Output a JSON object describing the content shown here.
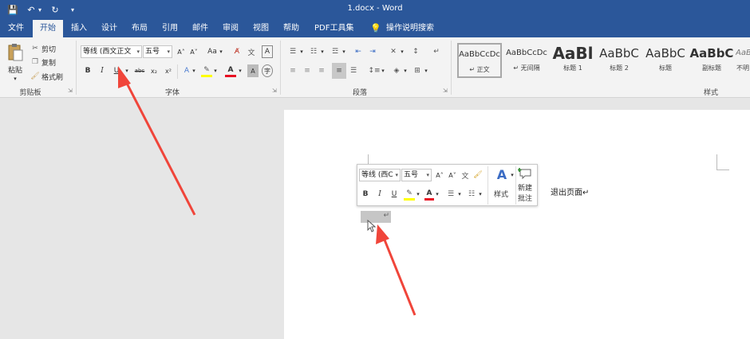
{
  "titlebar": {
    "title": "1.docx  -  Word",
    "quick_access": {
      "save": "💾",
      "undo": "↶",
      "undo_more": "▾",
      "redo": "↻",
      "customize": "▾"
    }
  },
  "tabs": [
    {
      "label": "文件"
    },
    {
      "label": "开始"
    },
    {
      "label": "插入"
    },
    {
      "label": "设计"
    },
    {
      "label": "布局"
    },
    {
      "label": "引用"
    },
    {
      "label": "邮件"
    },
    {
      "label": "审阅"
    },
    {
      "label": "视图"
    },
    {
      "label": "帮助"
    },
    {
      "label": "PDF工具集"
    },
    {
      "label": "操作说明搜索"
    }
  ],
  "clipboard": {
    "paste": "粘贴",
    "cut": "剪切",
    "copy": "复制",
    "format_painter": "格式刷",
    "group_label": "剪贴板"
  },
  "font": {
    "font_name": "等线 (西文正文",
    "font_size": "五号",
    "grow": "A˄",
    "shrink": "A˅",
    "case": "Aa",
    "clear": "A",
    "bold": "B",
    "italic": "I",
    "underline": "U",
    "strike": "abc",
    "subscript": "x₂",
    "superscript": "x²",
    "group_label": "字体"
  },
  "paragraph": {
    "group_label": "段落"
  },
  "styles": {
    "group_label": "样式",
    "items": [
      {
        "sample": "AaBbCcDc",
        "name": "↵ 正文"
      },
      {
        "sample": "AaBbCcDc",
        "name": "↵ 无间隔"
      },
      {
        "sample": "AaBl",
        "name": "标题 1"
      },
      {
        "sample": "AaBbC",
        "name": "标题 2"
      },
      {
        "sample": "AaBbC",
        "name": "标题"
      },
      {
        "sample": "AaBbC",
        "name": "副标题"
      },
      {
        "sample": "AaBl",
        "name": "不明"
      }
    ]
  },
  "mini_toolbar": {
    "font_name": "等线 (西C",
    "font_size": "五号",
    "bold": "B",
    "italic": "I",
    "underline": "U",
    "styles": "样式",
    "new_comment_line1": "新建",
    "new_comment_line2": "批注"
  },
  "document": {
    "text": "退出页面↵",
    "selection_mark": "↵"
  },
  "colors": {
    "titlebar": "#2b579a",
    "annotation_arrow": "#f0453a",
    "highlight": "#ffff00",
    "font_color": "#e81123"
  }
}
